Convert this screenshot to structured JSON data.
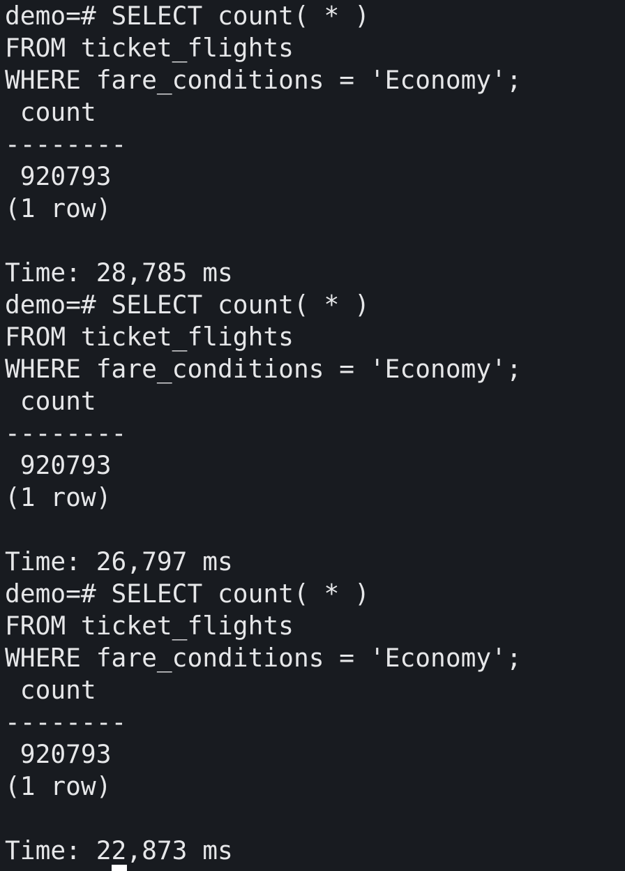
{
  "terminal": {
    "lines": [
      "demo=# SELECT count( * )",
      "FROM ticket_flights",
      "WHERE fare_conditions = 'Economy';",
      " count",
      "--------",
      " 920793",
      "(1 row)",
      "",
      "Time: 28,785 ms",
      "demo=# SELECT count( * )",
      "FROM ticket_flights",
      "WHERE fare_conditions = 'Economy';",
      " count",
      "--------",
      " 920793",
      "(1 row)",
      "",
      "Time: 26,797 ms",
      "demo=# SELECT count( * )",
      "FROM ticket_flights",
      "WHERE fare_conditions = 'Economy';",
      " count",
      "--------",
      " 920793",
      "(1 row)",
      "",
      "Time: 22,873 ms"
    ]
  },
  "colors": {
    "background": "#181b20",
    "foreground": "#e6e7e9",
    "cursor": "#ffffff"
  }
}
